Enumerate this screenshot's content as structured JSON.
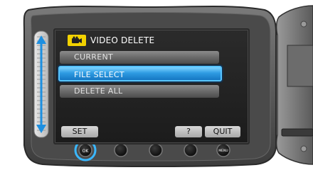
{
  "menu": {
    "title": "VIDEO DELETE",
    "items": [
      {
        "label": "CURRENT"
      },
      {
        "label": "FILE SELECT"
      },
      {
        "label": "DELETE ALL"
      }
    ]
  },
  "softkeys": {
    "set": "SET",
    "help": "?",
    "quit": "QUIT"
  },
  "buttons": {
    "ok": "OK",
    "menu": "MENU"
  },
  "colors": {
    "highlight": "#2e9be2",
    "title_icon": "#f2d200",
    "screen": "#1c1c1c",
    "body": "#5a5a5a"
  }
}
